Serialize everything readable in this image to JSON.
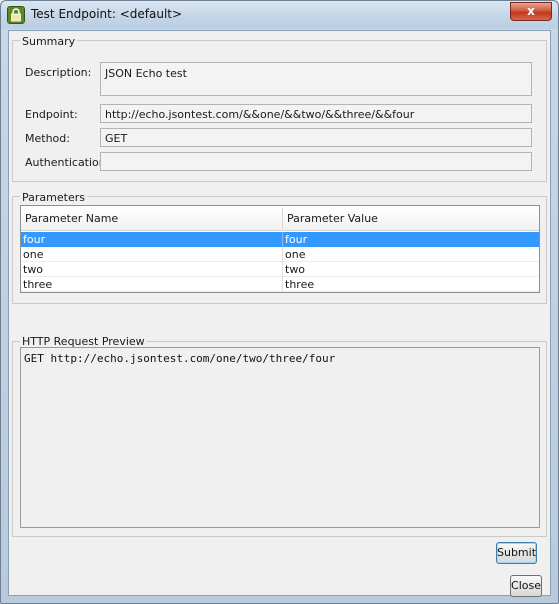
{
  "window": {
    "title": "Test Endpoint: <default>",
    "close_glyph": "x"
  },
  "summary": {
    "group_label": "Summary",
    "description_label": "Description:",
    "description_value": "JSON Echo test",
    "endpoint_label": "Endpoint:",
    "endpoint_value": "http://echo.jsontest.com/&&one/&&two/&&three/&&four",
    "method_label": "Method:",
    "method_value": "GET",
    "authentication_label": "Authentication:",
    "authentication_value": ""
  },
  "parameters": {
    "group_label": "Parameters",
    "columns": [
      "Parameter Name",
      "Parameter Value"
    ],
    "rows": [
      {
        "name": "four",
        "value": "four",
        "selected": true
      },
      {
        "name": "one",
        "value": "one",
        "selected": false
      },
      {
        "name": "two",
        "value": "two",
        "selected": false
      },
      {
        "name": "three",
        "value": "three",
        "selected": false
      }
    ]
  },
  "preview": {
    "group_label": "HTTP Request Preview",
    "text": "GET http://echo.jsontest.com/one/two/three/four"
  },
  "buttons": {
    "submit_label": "Submit",
    "close_label": "Close"
  },
  "colors": {
    "selection": "#3399ff",
    "close_button": "#c0391c"
  }
}
